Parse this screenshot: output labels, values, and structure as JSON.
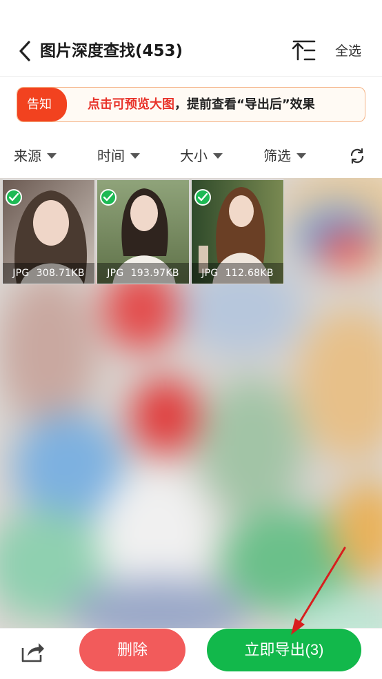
{
  "header": {
    "title": "图片深度查找(453)",
    "select_all": "全选"
  },
  "notice": {
    "tag": "告知",
    "highlight": "点击可预览大图",
    "rest": "，提前查看“导出后”效果"
  },
  "filters": [
    {
      "label": "来源"
    },
    {
      "label": "时间"
    },
    {
      "label": "大小"
    },
    {
      "label": "筛选"
    }
  ],
  "photos": [
    {
      "format": "JPG",
      "size": "308.71KB",
      "checked": true
    },
    {
      "format": "JPG",
      "size": "193.97KB",
      "checked": true
    },
    {
      "format": "JPG",
      "size": "112.68KB",
      "checked": true
    }
  ],
  "bottom": {
    "delete_label": "删除",
    "export_label": "立即导出(3)"
  },
  "colors": {
    "accent_green": "#12b84b",
    "delete_red": "#f25b5b",
    "notice_red": "#f2421f",
    "highlight_red": "#e8332a",
    "annotation_arrow": "#d81e1e"
  },
  "icons": {
    "back": "chevron-left-icon",
    "sort": "sort-icon",
    "refresh": "refresh-icon",
    "check": "check-icon",
    "share": "share-icon"
  }
}
